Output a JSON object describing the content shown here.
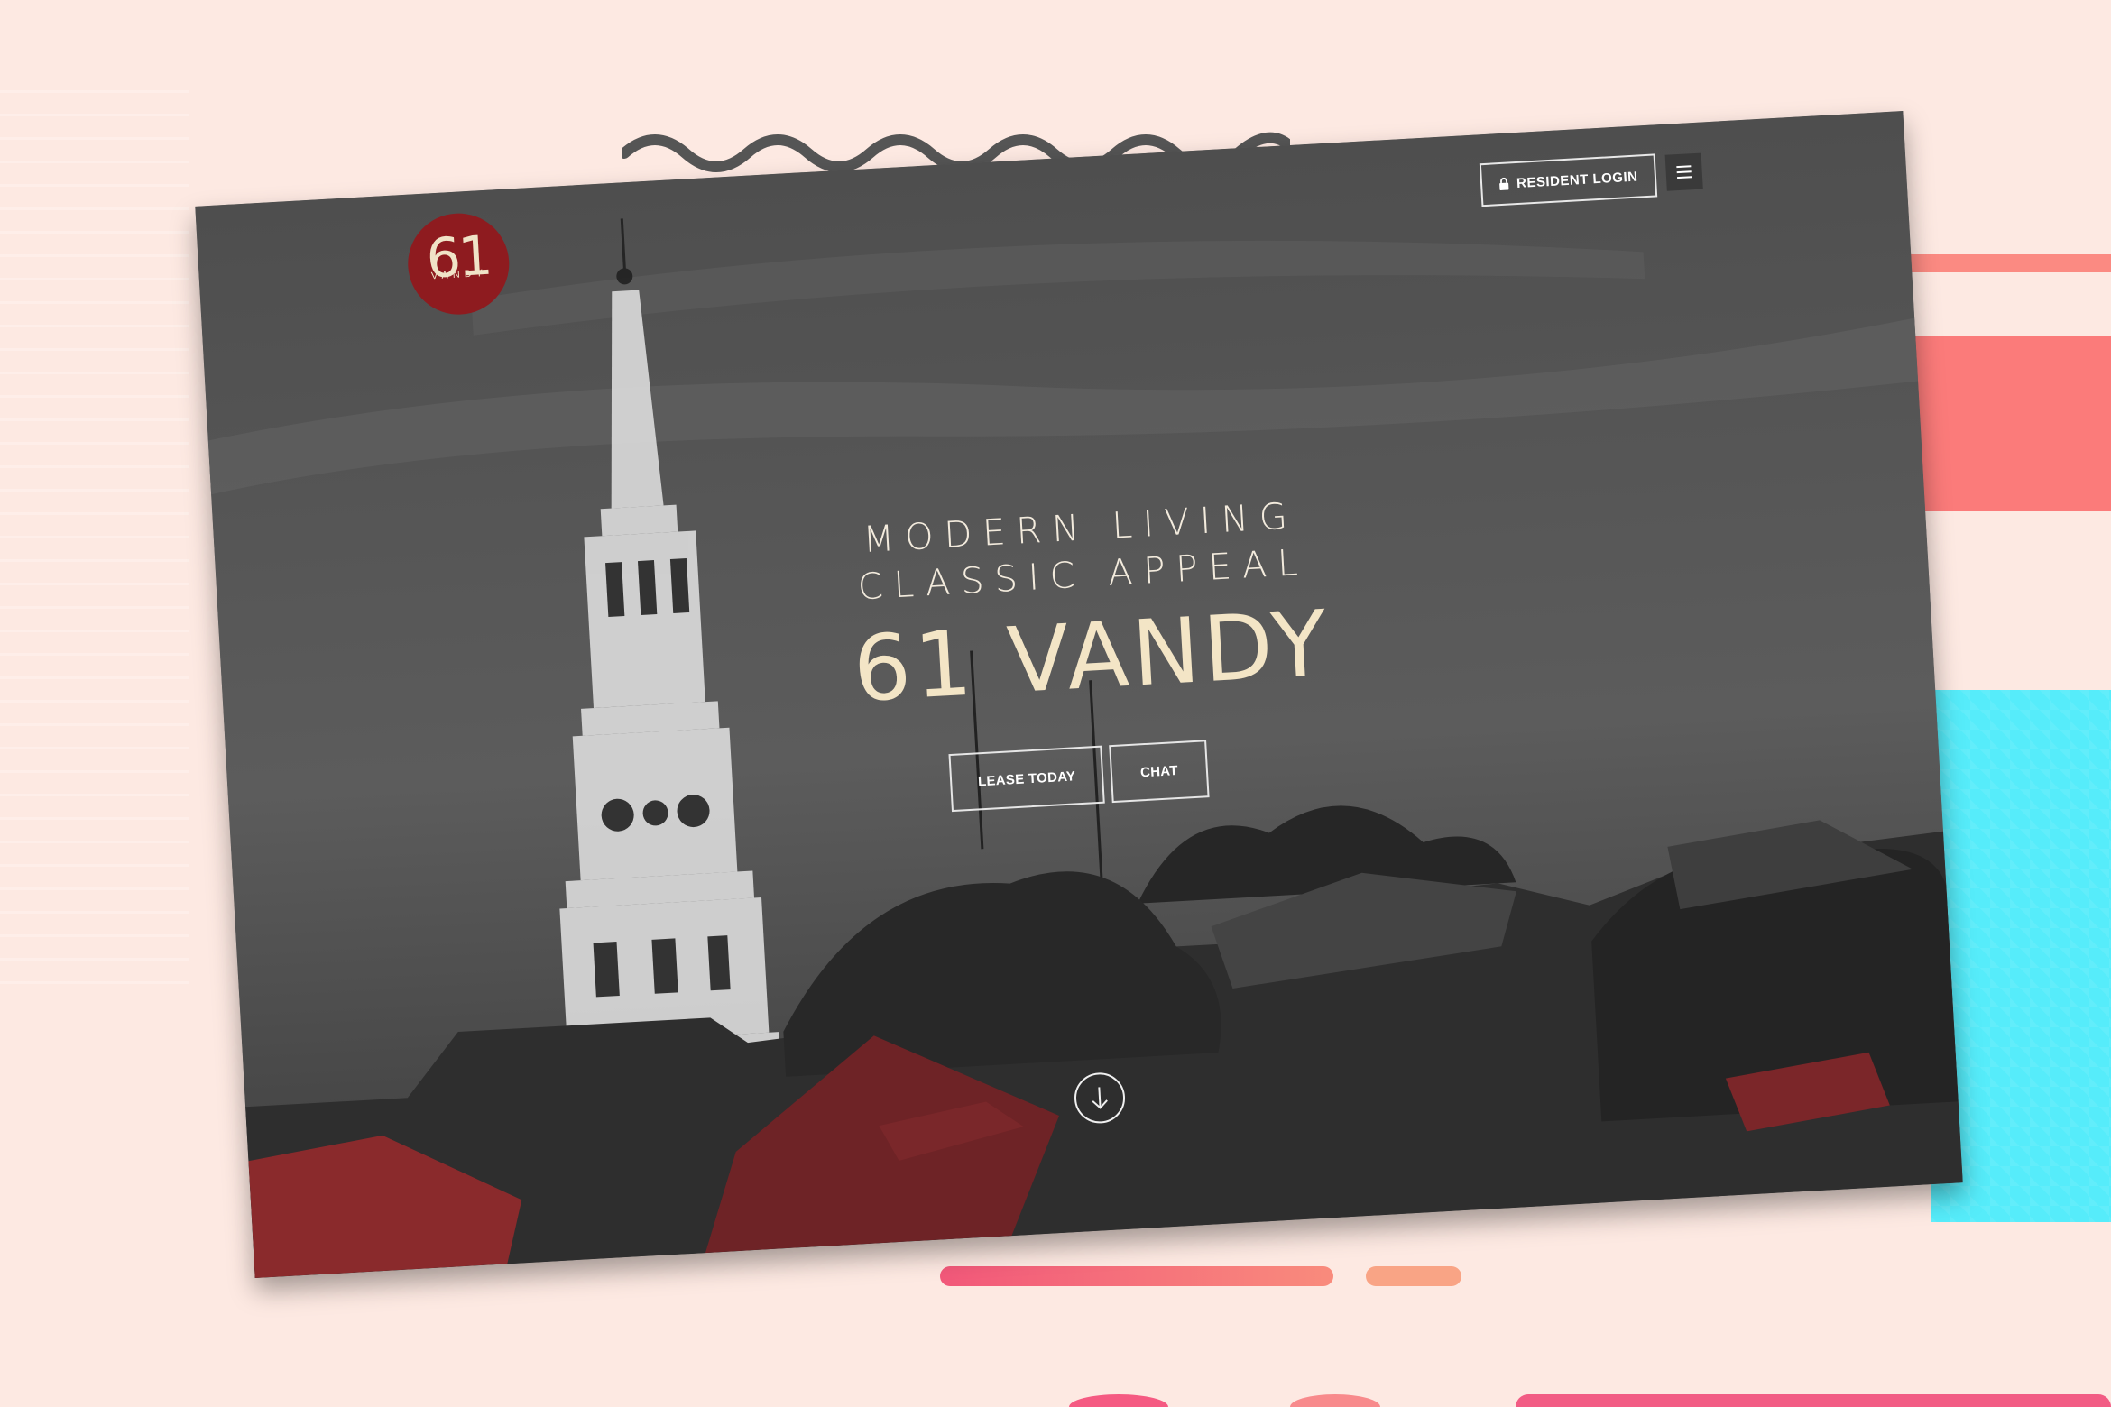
{
  "brand": {
    "logo_number": "61",
    "logo_word": "VANDY",
    "logo_color": "#8e1b1f"
  },
  "header": {
    "resident_login_label": "RESIDENT LOGIN",
    "resident_login_icon": "lock-icon",
    "menu_icon": "hamburger-menu-icon"
  },
  "hero": {
    "tagline_line1": "MODERN LIVING",
    "tagline_line2": "CLASSIC APPEAL",
    "title": "61 VANDY",
    "lease_button_label": "LEASE TODAY",
    "chat_button_label": "CHAT",
    "scroll_icon": "arrow-down-circle-icon"
  },
  "colors": {
    "background": "#fde9e2",
    "accent_coral": "#fb7b7a",
    "accent_cyan": "#56ecfa",
    "title_cream": "#f3e5c6"
  }
}
